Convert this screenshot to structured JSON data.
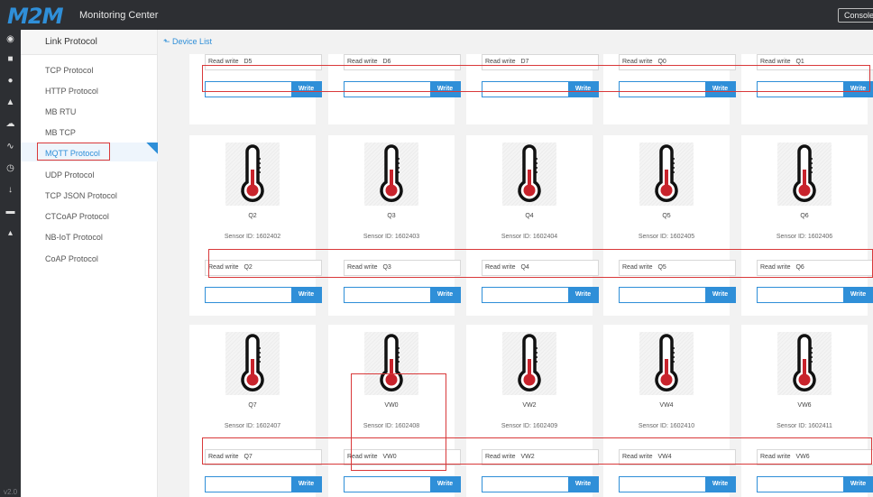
{
  "header": {
    "logo": "M2M",
    "title": "Monitoring Center",
    "console_label": "Console"
  },
  "iconbar": {
    "icons": [
      "target-icon",
      "monitor-icon",
      "location-icon",
      "bell-icon",
      "cloud-icon",
      "chart-icon",
      "clock-icon",
      "download-icon",
      "card-icon",
      "user-icon"
    ],
    "version": "v2.0"
  },
  "sidebar": {
    "header": "Link Protocol",
    "items": [
      {
        "label": "TCP Protocol"
      },
      {
        "label": "HTTP Protocol"
      },
      {
        "label": "MB RTU"
      },
      {
        "label": "MB TCP"
      },
      {
        "label": "MQTT Protocol",
        "active": true
      },
      {
        "label": "UDP Protocol"
      },
      {
        "label": "TCP JSON Protocol"
      },
      {
        "label": "CTCoAP Protocol"
      },
      {
        "label": "NB-IoT Protocol"
      },
      {
        "label": "CoAP Protocol"
      }
    ]
  },
  "breadcrumb": "Device List",
  "controls": {
    "read_write_label": "Read write",
    "write_button": "Write"
  },
  "rows": [
    {
      "partial": true,
      "devices": [
        {
          "read_value": "D5"
        },
        {
          "read_value": "D6"
        },
        {
          "read_value": "D7"
        },
        {
          "read_value": "Q0"
        },
        {
          "read_value": "Q1"
        }
      ]
    },
    {
      "partial": false,
      "devices": [
        {
          "name": "Q2",
          "sensor": "Sensor ID: 1602402",
          "read_value": "Q2"
        },
        {
          "name": "Q3",
          "sensor": "Sensor ID: 1602403",
          "read_value": "Q3"
        },
        {
          "name": "Q4",
          "sensor": "Sensor ID: 1602404",
          "read_value": "Q4"
        },
        {
          "name": "Q5",
          "sensor": "Sensor ID: 1602405",
          "read_value": "Q5"
        },
        {
          "name": "Q6",
          "sensor": "Sensor ID: 1602406",
          "read_value": "Q6"
        }
      ]
    },
    {
      "partial": false,
      "devices": [
        {
          "name": "Q7",
          "sensor": "Sensor ID: 1602407",
          "read_value": "Q7"
        },
        {
          "name": "VW0",
          "sensor": "Sensor ID: 1602408",
          "read_value": "VW0"
        },
        {
          "name": "VW2",
          "sensor": "Sensor ID: 1602409",
          "read_value": "VW2"
        },
        {
          "name": "VW4",
          "sensor": "Sensor ID: 1602410",
          "read_value": "VW4"
        },
        {
          "name": "VW6",
          "sensor": "Sensor ID: 1602411",
          "read_value": "VW6"
        }
      ]
    }
  ],
  "colors": {
    "accent": "#2f8fd8",
    "highlight": "#d9393a",
    "thermometer": "#c8232c"
  }
}
